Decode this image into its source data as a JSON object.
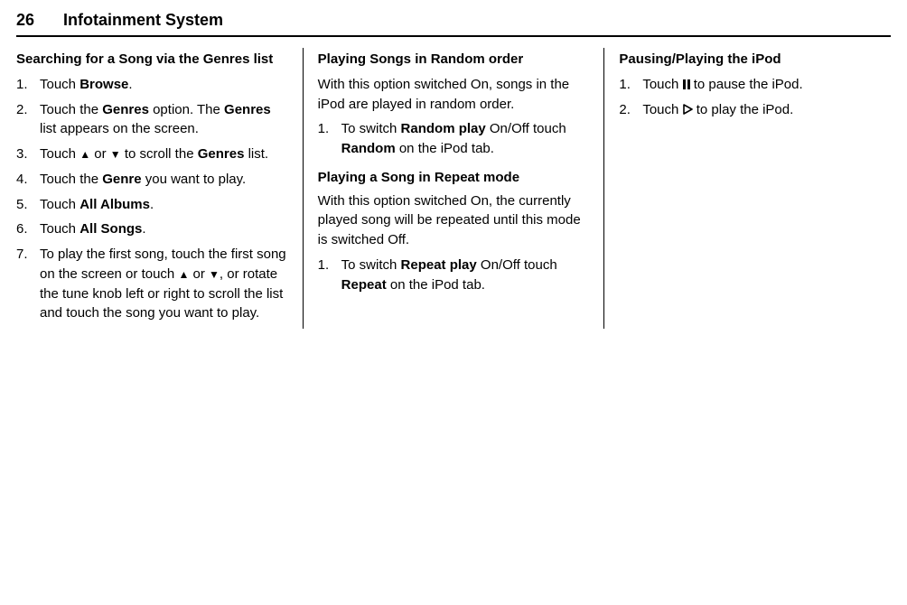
{
  "header": {
    "page_number": "26",
    "title": "Infotainment System"
  },
  "col1": {
    "heading": "Searching for a Song via the Genres list",
    "steps": {
      "s1_a": "Touch ",
      "s1_b": "Browse",
      "s1_c": ".",
      "s2_a": "Touch the ",
      "s2_b": "Genres",
      "s2_c": " option. The ",
      "s2_d": "Genres",
      "s2_e": " list appears on the screen.",
      "s3_a": "Touch ",
      "s3_b": " or ",
      "s3_c": " to scroll the ",
      "s3_d": "Genres",
      "s3_e": " list.",
      "s4_a": "Touch the ",
      "s4_b": "Genre",
      "s4_c": " you want to play.",
      "s5_a": "Touch ",
      "s5_b": "All Albums",
      "s5_c": ".",
      "s6_a": "Touch ",
      "s6_b": "All Songs",
      "s6_c": ".",
      "s7_a": "To play the first song, touch the first song on the screen or touch ",
      "s7_b": " or ",
      "s7_c": ", or rotate the tune knob left or right to scroll the list and touch the song you want to play."
    }
  },
  "col2": {
    "heading1": "Playing Songs in Random order",
    "para1": "With this option switched On, songs in the iPod are played in random order.",
    "r1_a": "To switch ",
    "r1_b": "Random play",
    "r1_c": " On/Off touch ",
    "r1_d": "Random",
    "r1_e": " on the iPod tab.",
    "heading2": "Playing a Song in Repeat mode",
    "para2": "With this option switched On, the currently played song will be repeated until this mode is switched Off.",
    "p1_a": "To switch ",
    "p1_b": "Repeat play",
    "p1_c": " On/Off touch ",
    "p1_d": "Repeat",
    "p1_e": " on the iPod tab."
  },
  "col3": {
    "heading": "Pausing/Playing the iPod",
    "s1_a": "Touch ",
    "s1_b": " to pause the iPod.",
    "s2_a": "Touch ",
    "s2_b": " to play the iPod."
  }
}
